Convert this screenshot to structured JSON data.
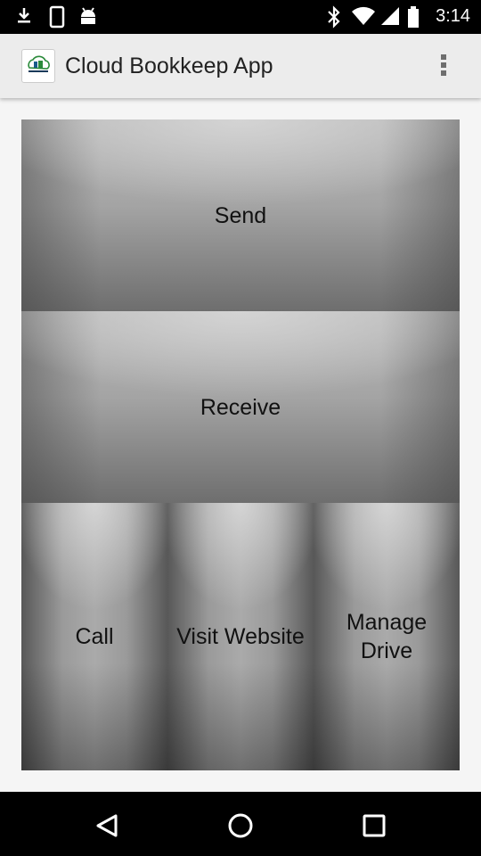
{
  "status_bar": {
    "time": "3:14",
    "icons": [
      "download-icon",
      "phone-icon",
      "android-icon",
      "bluetooth-icon",
      "wifi-icon",
      "signal-icon",
      "battery-icon"
    ]
  },
  "action_bar": {
    "title": "Cloud Bookkeep App",
    "app_icon": "cloud-bookkeeping-logo",
    "menu_icon": "overflow-menu-icon"
  },
  "buttons": {
    "send": "Send",
    "receive": "Receive",
    "call": "Call",
    "visit_website": "Visit Website",
    "manage_drive_line1": "Manage",
    "manage_drive_line2": "Drive"
  },
  "nav_bar": {
    "icons": [
      "back-icon",
      "home-icon",
      "recents-icon"
    ]
  }
}
